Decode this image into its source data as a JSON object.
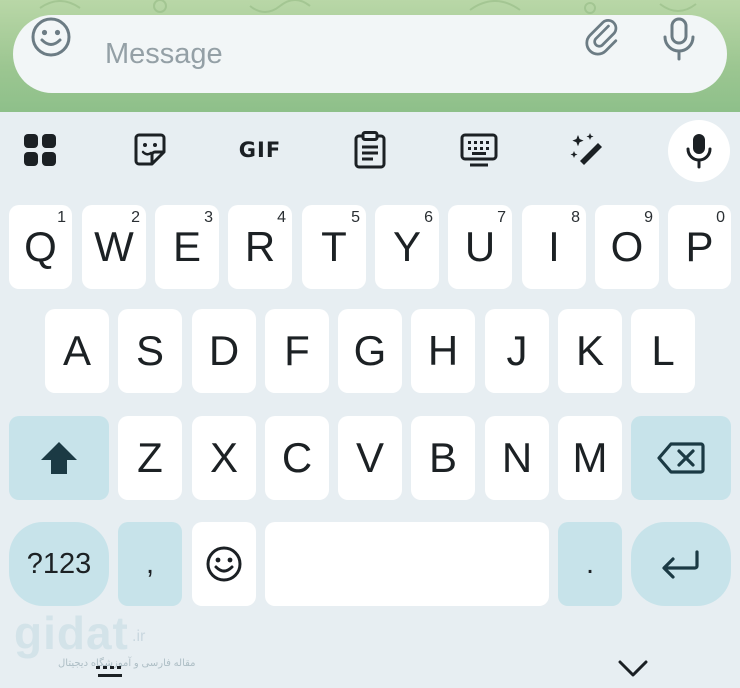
{
  "message_bar": {
    "placeholder": "Message",
    "emoji_icon": "smiley-icon",
    "attach_icon": "paperclip-icon",
    "mic_icon": "microphone-icon"
  },
  "toolbar": {
    "apps_icon": "apps-grid-icon",
    "sticker_icon": "sticker-icon",
    "gif_label": "GIF",
    "clipboard_icon": "clipboard-icon",
    "keyboard_icon": "keyboard-icon",
    "magic_icon": "magic-wand-icon",
    "voice_icon": "microphone-icon"
  },
  "rows": {
    "row1": [
      {
        "label": "Q",
        "hint": "1"
      },
      {
        "label": "W",
        "hint": "2"
      },
      {
        "label": "E",
        "hint": "3"
      },
      {
        "label": "R",
        "hint": "4"
      },
      {
        "label": "T",
        "hint": "5"
      },
      {
        "label": "Y",
        "hint": "6"
      },
      {
        "label": "U",
        "hint": "7"
      },
      {
        "label": "I",
        "hint": "8"
      },
      {
        "label": "O",
        "hint": "9"
      },
      {
        "label": "P",
        "hint": "0"
      }
    ],
    "row2": [
      "A",
      "S",
      "D",
      "F",
      "G",
      "H",
      "J",
      "K",
      "L"
    ],
    "row3": [
      "Z",
      "X",
      "C",
      "V",
      "B",
      "N",
      "M"
    ],
    "bottom": {
      "symbols": "?123",
      "comma": ",",
      "period": "."
    }
  },
  "watermark": {
    "brand": "gidat",
    "tld": ".ir",
    "subtitle": "مقاله فارسی و آموزشگاه دیجیتال"
  },
  "colors": {
    "keyboard_bg": "#e7eef2",
    "key_bg": "#ffffff",
    "function_key_bg": "#c7e3ea",
    "text": "#1c2124"
  }
}
